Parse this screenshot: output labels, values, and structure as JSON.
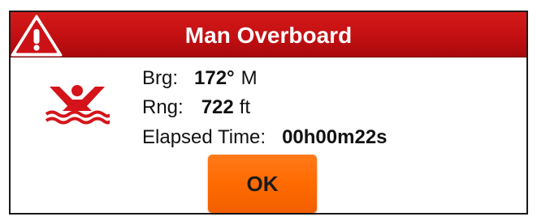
{
  "dialog": {
    "title": "Man Overboard",
    "title_icon": "warning-triangle-icon",
    "status_icon": "man-overboard-icon",
    "accent_color": "#c8141a",
    "button_color": "#ff6a00"
  },
  "details": {
    "bearing": {
      "label": "Brg:",
      "value": "172°",
      "unit": "M"
    },
    "range": {
      "label": "Rng:",
      "value": "722",
      "unit": "ft"
    },
    "elapsed": {
      "label": "Elapsed Time:",
      "value": "00h00m22s"
    }
  },
  "actions": {
    "ok_label": "OK"
  }
}
